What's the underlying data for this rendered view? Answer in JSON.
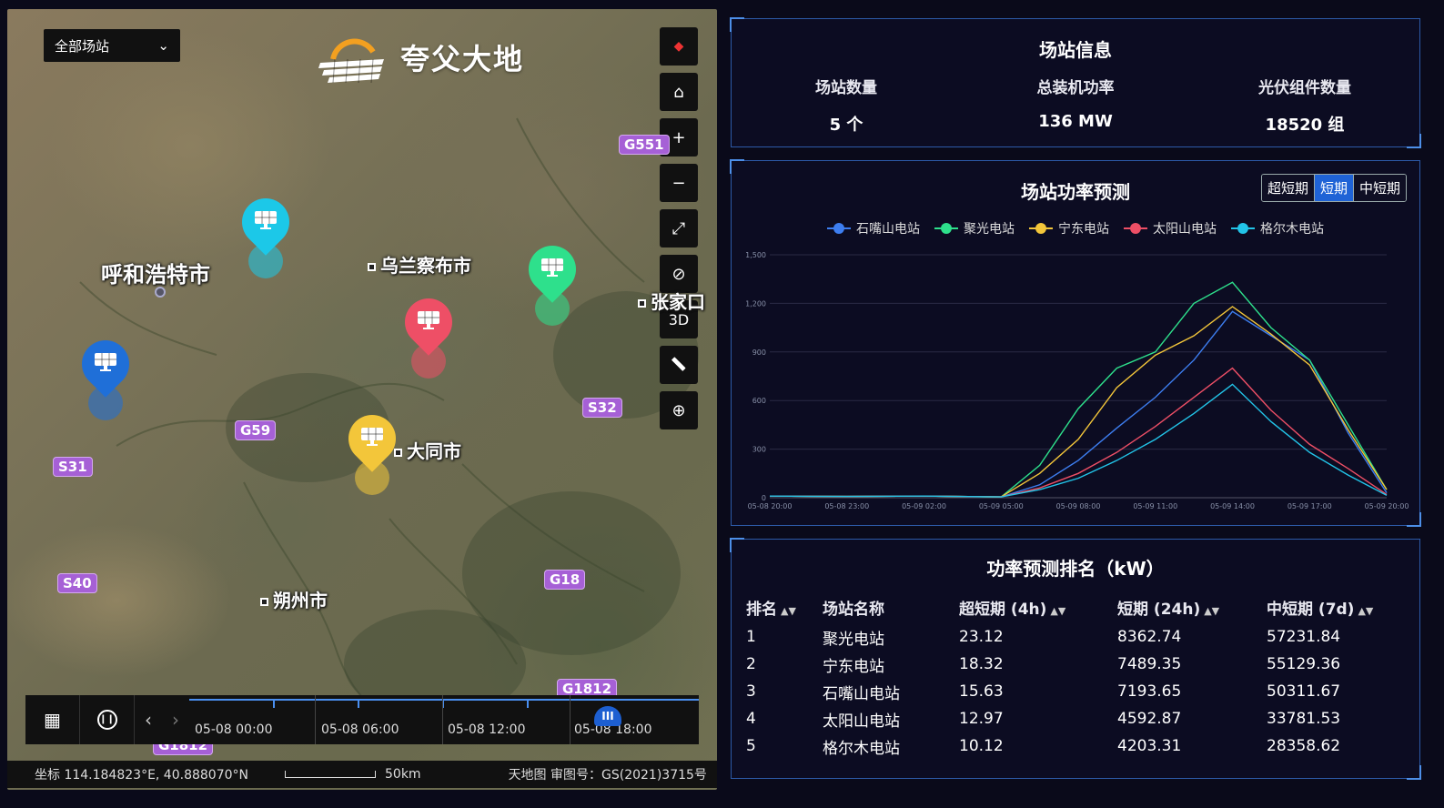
{
  "map": {
    "station_select": "全部场站",
    "brand": "夸父大地",
    "tools": [
      {
        "name": "compass-icon",
        "glyph": "◆"
      },
      {
        "name": "home-icon",
        "glyph": "⌂"
      },
      {
        "name": "zoom-in-icon",
        "glyph": "+"
      },
      {
        "name": "zoom-out-icon",
        "glyph": "−"
      },
      {
        "name": "fullscreen-icon",
        "glyph": "⤢"
      },
      {
        "name": "hide-icon",
        "glyph": "⊘"
      },
      {
        "name": "3d-toggle",
        "glyph": "3D"
      },
      {
        "name": "ruler-icon",
        "glyph": "📏"
      },
      {
        "name": "locate-icon",
        "glyph": "⊕"
      }
    ],
    "cities": {
      "huhehaote": "呼和浩特市",
      "wulanchabu": "乌兰察布市",
      "zhangjiakou": "张家口",
      "datong": "大同市",
      "shuozhou": "朔州市"
    },
    "roads": {
      "g551": "G551",
      "g59": "G59",
      "s32": "S32",
      "s31": "S31",
      "s40": "S40",
      "g18": "G18",
      "g1812a": "G1812",
      "g1812b": "G1812"
    },
    "pin_colors": {
      "cyan": "#1cc8e8",
      "green": "#2ee08c",
      "red": "#ee4f66",
      "blue": "#1f6fd8",
      "yellow": "#f3c63a"
    },
    "timeline": {
      "labels": [
        "05-08 00:00",
        "05-08 06:00",
        "05-08 12:00",
        "05-08 18:00"
      ],
      "knob": "III"
    },
    "status": {
      "coords": "坐标 114.184823°E, 40.888070°N",
      "scale": "50km",
      "attribution": "天地图 审图号：GS(2021)3715号"
    }
  },
  "info": {
    "title": "场站信息",
    "items": [
      {
        "label": "场站数量",
        "value": "5 个"
      },
      {
        "label": "总装机功率",
        "value": "136 MW"
      },
      {
        "label": "光伏组件数量",
        "value": "18520 组"
      }
    ]
  },
  "forecast": {
    "title": "场站功率预测",
    "tabs": [
      {
        "label": "超短期",
        "active": false
      },
      {
        "label": "短期",
        "active": true
      },
      {
        "label": "中短期",
        "active": false
      }
    ]
  },
  "chart_data": {
    "type": "line",
    "title": "场站功率预测",
    "x": [
      "05-08 20:00",
      "05-08 23:00",
      "05-09 02:00",
      "05-09 05:00",
      "05-09 08:00",
      "05-09 11:00",
      "05-09 14:00",
      "05-09 17:00",
      "05-09 20:00"
    ],
    "ylim": [
      0,
      1500
    ],
    "yticks": [
      0,
      300,
      600,
      900,
      1200,
      1500
    ],
    "grid": true,
    "legend": "top",
    "series": [
      {
        "name": "石嘴山电站",
        "color": "#3d7ef0",
        "points": [
          [
            0,
            10
          ],
          [
            1,
            8
          ],
          [
            2,
            10
          ],
          [
            3,
            5
          ],
          [
            3.5,
            80
          ],
          [
            4,
            230
          ],
          [
            4.5,
            430
          ],
          [
            5,
            620
          ],
          [
            5.5,
            850
          ],
          [
            6,
            1150
          ],
          [
            6.5,
            1000
          ],
          [
            7,
            850
          ],
          [
            7.5,
            400
          ],
          [
            8,
            30
          ]
        ]
      },
      {
        "name": "聚光电站",
        "color": "#2ee08c",
        "points": [
          [
            0,
            10
          ],
          [
            1,
            8
          ],
          [
            2,
            10
          ],
          [
            3,
            5
          ],
          [
            3.5,
            200
          ],
          [
            4,
            550
          ],
          [
            4.5,
            800
          ],
          [
            5,
            900
          ],
          [
            5.5,
            1200
          ],
          [
            6,
            1330
          ],
          [
            6.5,
            1050
          ],
          [
            7,
            850
          ],
          [
            7.5,
            450
          ],
          [
            8,
            50
          ]
        ]
      },
      {
        "name": "宁东电站",
        "color": "#f3c63a",
        "points": [
          [
            0,
            10
          ],
          [
            1,
            8
          ],
          [
            2,
            10
          ],
          [
            3,
            5
          ],
          [
            3.5,
            150
          ],
          [
            4,
            360
          ],
          [
            4.5,
            680
          ],
          [
            5,
            880
          ],
          [
            5.5,
            1000
          ],
          [
            6,
            1180
          ],
          [
            6.5,
            1010
          ],
          [
            7,
            820
          ],
          [
            7.5,
            420
          ],
          [
            8,
            50
          ]
        ]
      },
      {
        "name": "太阳山电站",
        "color": "#ee4f66",
        "points": [
          [
            0,
            10
          ],
          [
            1,
            8
          ],
          [
            2,
            10
          ],
          [
            3,
            5
          ],
          [
            3.5,
            60
          ],
          [
            4,
            150
          ],
          [
            4.5,
            280
          ],
          [
            5,
            440
          ],
          [
            5.5,
            620
          ],
          [
            6,
            800
          ],
          [
            6.5,
            540
          ],
          [
            7,
            330
          ],
          [
            7.5,
            180
          ],
          [
            8,
            20
          ]
        ]
      },
      {
        "name": "格尔木电站",
        "color": "#22c4e8",
        "points": [
          [
            0,
            10
          ],
          [
            1,
            8
          ],
          [
            2,
            10
          ],
          [
            3,
            5
          ],
          [
            3.5,
            50
          ],
          [
            4,
            120
          ],
          [
            4.5,
            230
          ],
          [
            5,
            360
          ],
          [
            5.5,
            520
          ],
          [
            6,
            700
          ],
          [
            6.5,
            470
          ],
          [
            7,
            280
          ],
          [
            7.5,
            140
          ],
          [
            8,
            15
          ]
        ]
      }
    ]
  },
  "rank": {
    "title": "功率预测排名（kW）",
    "headers": [
      "排名",
      "场站名称",
      "超短期 (4h)",
      "短期 (24h)",
      "中短期 (7d)"
    ],
    "rows": [
      [
        "1",
        "聚光电站",
        "23.12",
        "8362.74",
        "57231.84"
      ],
      [
        "2",
        "宁东电站",
        "18.32",
        "7489.35",
        "55129.36"
      ],
      [
        "3",
        "石嘴山电站",
        "15.63",
        "7193.65",
        "50311.67"
      ],
      [
        "4",
        "太阳山电站",
        "12.97",
        "4592.87",
        "33781.53"
      ],
      [
        "5",
        "格尔木电站",
        "10.12",
        "4203.31",
        "28358.62"
      ]
    ]
  }
}
